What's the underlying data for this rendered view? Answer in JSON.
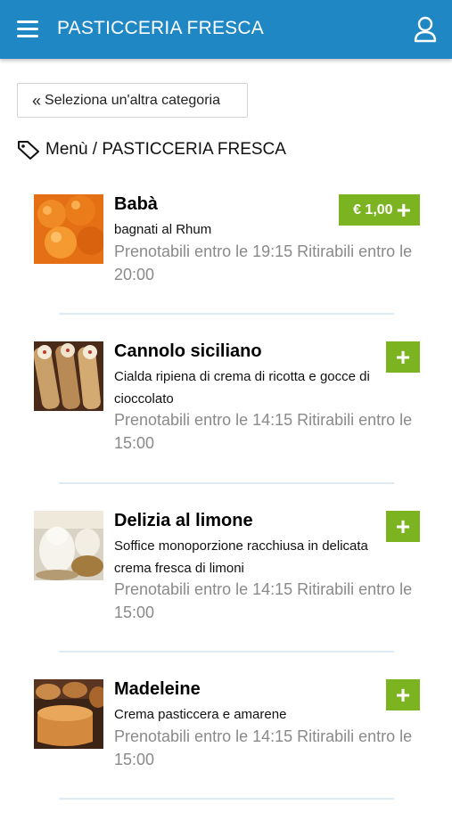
{
  "header": {
    "title": "PASTICCERIA FRESCA",
    "color": "#1f87c4"
  },
  "back_button": {
    "icon": "double-chevron-left-icon",
    "label": "Seleziona un'altra categoria"
  },
  "breadcrumb": {
    "icon": "tag-icon",
    "label": "Menù / PASTICCERIA FRESCA"
  },
  "accent_color": "#7bb420",
  "products": [
    {
      "name": "Babà",
      "description": "bagnati al Rhum",
      "availability": "Prenotabili entro le 19:15 Ritirabili entro le 20:00",
      "price": "€ 1,00"
    },
    {
      "name": "Cannolo siciliano",
      "description": "Cialda ripiena di crema di ricotta e gocce di cioccolato",
      "availability": "Prenotabili entro le 14:15 Ritirabili entro le 15:00",
      "price": ""
    },
    {
      "name": "Delizia al limone",
      "description": "Soffice monoporzione racchiusa in delicata crema fresca di limoni",
      "availability": "Prenotabili entro le 14:15 Ritirabili entro le 15:00",
      "price": ""
    },
    {
      "name": "Madeleine",
      "description": "Crema pasticcera e amarene",
      "availability": "Prenotabili entro le 14:15 Ritirabili entro le 15:00",
      "price": ""
    }
  ]
}
